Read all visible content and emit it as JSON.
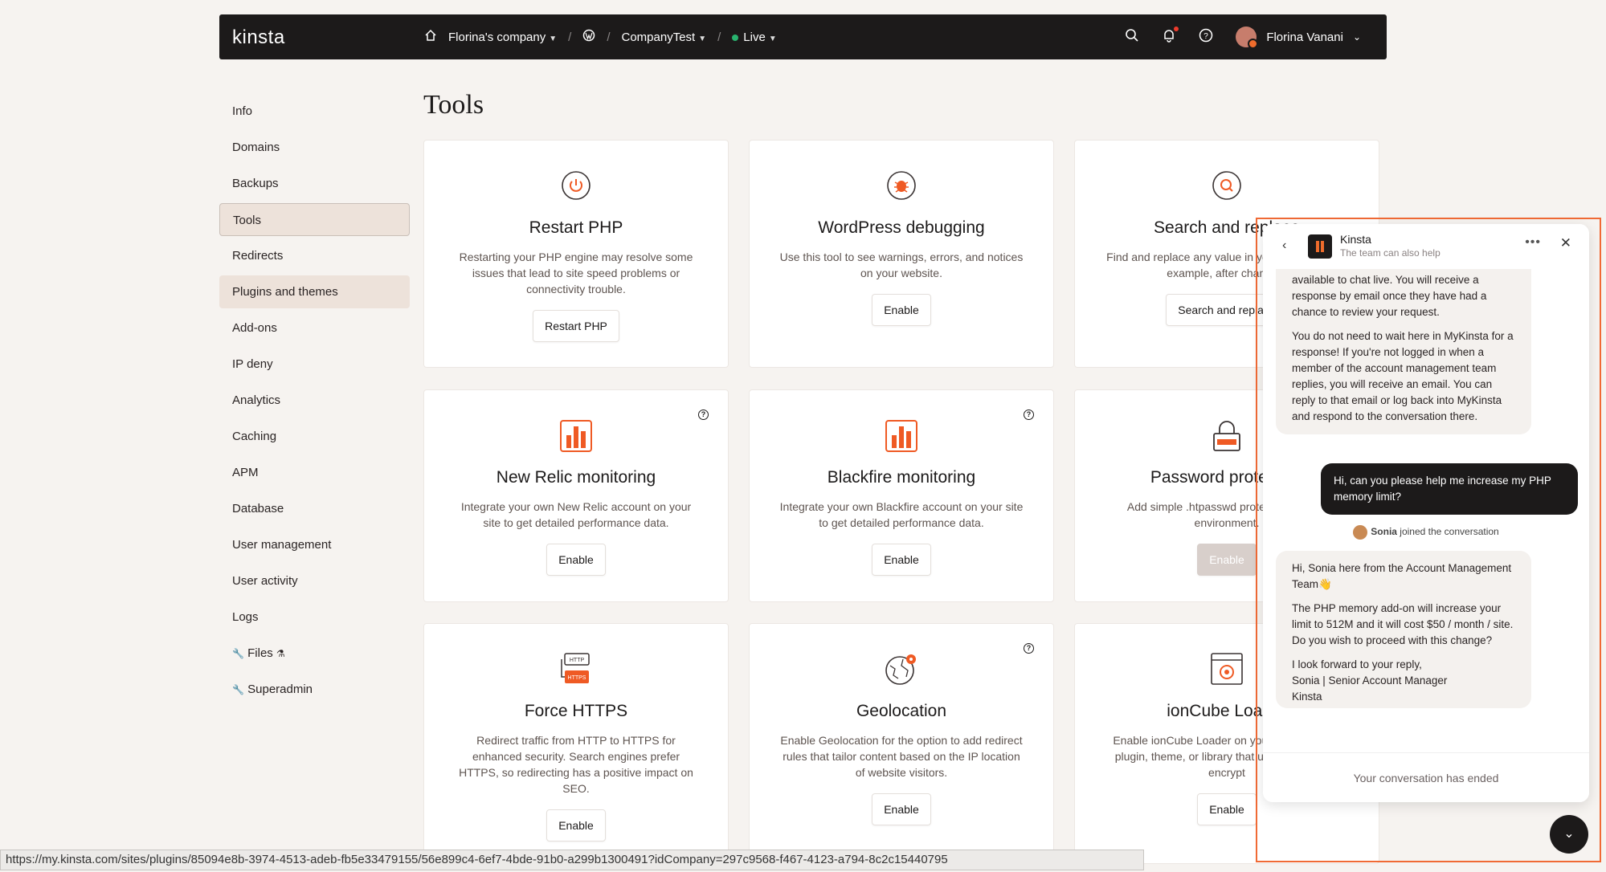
{
  "topbar": {
    "logo": "kinsta",
    "company": "Florina's company",
    "site": "CompanyTest",
    "environment": "Live",
    "user": "Florina Vanani"
  },
  "sidebar": {
    "items": [
      {
        "label": "Info"
      },
      {
        "label": "Domains"
      },
      {
        "label": "Backups"
      },
      {
        "label": "Tools"
      },
      {
        "label": "Redirects"
      },
      {
        "label": "Plugins and themes"
      },
      {
        "label": "Add-ons"
      },
      {
        "label": "IP deny"
      },
      {
        "label": "Analytics"
      },
      {
        "label": "Caching"
      },
      {
        "label": "APM"
      },
      {
        "label": "Database"
      },
      {
        "label": "User management"
      },
      {
        "label": "User activity"
      },
      {
        "label": "Logs"
      },
      {
        "label": "Files"
      },
      {
        "label": "Superadmin"
      }
    ]
  },
  "page": {
    "title": "Tools"
  },
  "cards": [
    {
      "title": "Restart PHP",
      "desc": "Restarting your PHP engine may resolve some issues that lead to site speed problems or connectivity trouble.",
      "button": "Restart PHP"
    },
    {
      "title": "WordPress debugging",
      "desc": "Use this tool to see warnings, errors, and notices on your website.",
      "button": "Enable"
    },
    {
      "title": "Search and replace",
      "desc": "Find and replace any value in your database, for example, after changing",
      "button": "Search and replace"
    },
    {
      "title": "New Relic monitoring",
      "desc": "Integrate your own New Relic account on your site to get detailed performance data.",
      "button": "Enable"
    },
    {
      "title": "Blackfire monitoring",
      "desc": "Integrate your own Blackfire account on your site to get detailed performance data.",
      "button": "Enable"
    },
    {
      "title": "Password protection",
      "desc": "Add simple .htpasswd protection to your environment.",
      "button": "Enable"
    },
    {
      "title": "Force HTTPS",
      "desc": "Redirect traffic from HTTP to HTTPS for enhanced security. Search engines prefer HTTPS, so redirecting has a positive impact on SEO.",
      "button": "Enable"
    },
    {
      "title": "Geolocation",
      "desc": "Enable Geolocation for the option to add redirect rules that tailor content based on the IP location of website visitors.",
      "button": "Enable"
    },
    {
      "title": "ionCube Loader",
      "desc": "Enable ionCube Loader on your site if it has a plugin, theme, or library that uses ionCube to encrypt",
      "button": "Enable"
    }
  ],
  "chat": {
    "name": "Kinsta",
    "subtitle": "The team can also help",
    "msg1_p1": "available to chat live. You will receive a response by email once they have had a chance to review your request.",
    "msg1_p2": "You do not need to wait here in MyKinsta for a response! If you're not logged in when a member of the account management team replies, you will receive an email. You can reply to that email or log back into MyKinsta and respond to the conversation there.",
    "user_msg": "Hi, can you please help me increase my PHP memory limit?",
    "joined_name": "Sonia",
    "joined_text": "joined the conversation",
    "msg2_p1": "Hi, Sonia here from the Account Management Team👋",
    "msg2_p2": "The PHP memory add-on will increase your limit to 512M and it will cost $50 / month / site. Do you wish to proceed with this change?",
    "msg2_p3": "I look forward to your reply,",
    "msg2_p4": "Sonia | Senior Account Manager",
    "msg2_p5": "Kinsta",
    "ended": "Your conversation has ended"
  },
  "status_url": "https://my.kinsta.com/sites/plugins/85094e8b-3974-4513-adeb-fb5e33479155/56e899c4-6ef7-4bde-91b0-a299b1300491?idCompany=297c9568-f467-4123-a794-8c2c15440795"
}
